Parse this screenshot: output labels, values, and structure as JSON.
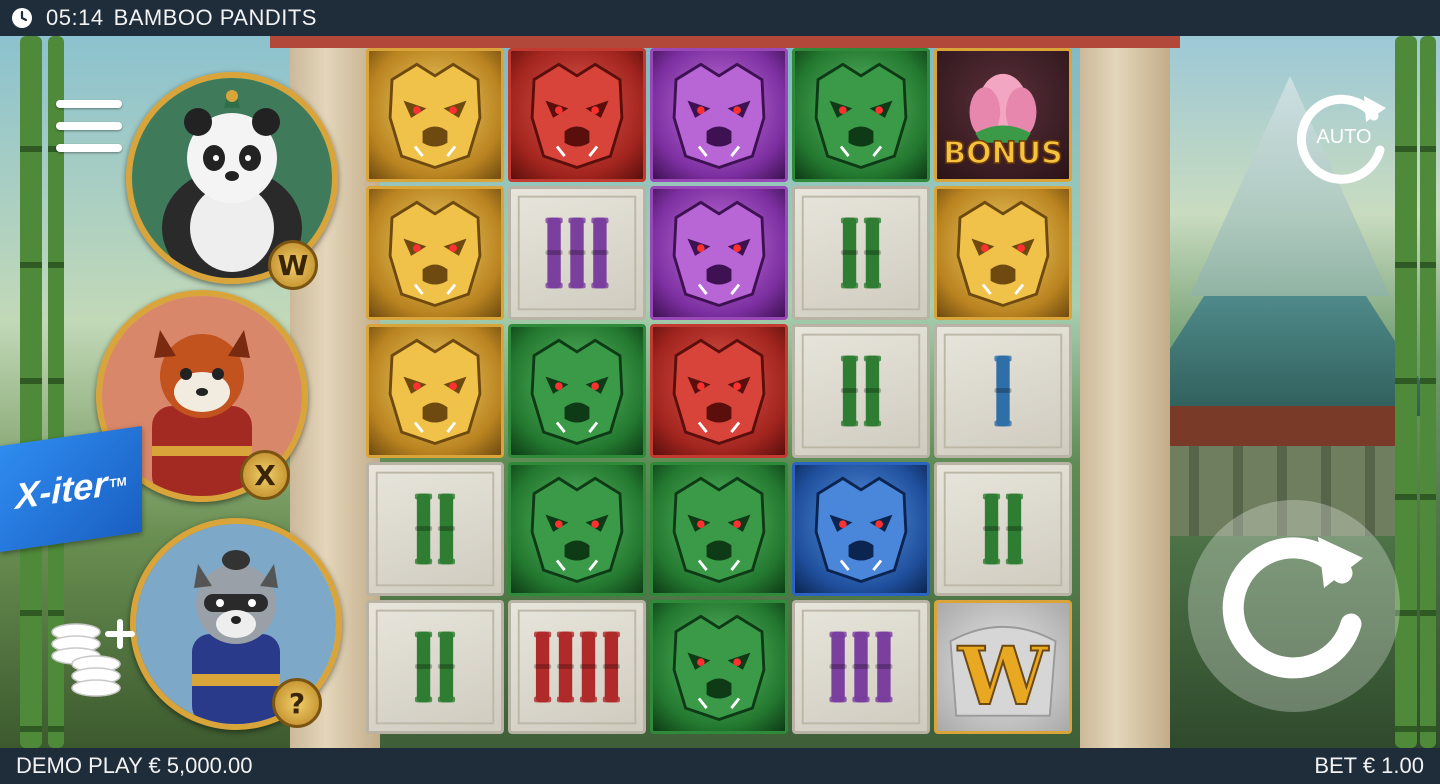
{
  "status_bar": {
    "time": "05:14",
    "title": "BAMBOO PANDITS"
  },
  "footer": {
    "balance_label": "DEMO PLAY € 5,000.00",
    "bet_label": "BET € 1.00"
  },
  "controls": {
    "auto_label": "AUTO",
    "xiter_label": "X-iter",
    "xiter_tm": "TM"
  },
  "characters": [
    {
      "name": "panda",
      "badge": "W"
    },
    {
      "name": "red-panda",
      "badge": "X"
    },
    {
      "name": "raccoon",
      "badge": "?"
    }
  ],
  "reels": {
    "rows": [
      [
        "gold-mask",
        "red-mask",
        "purple-mask",
        "green-mask",
        "bonus"
      ],
      [
        "gold-mask",
        "bamboo-3-purple",
        "purple-mask",
        "bamboo-2-green",
        "gold-mask"
      ],
      [
        "gold-mask",
        "green-mask",
        "red-mask",
        "bamboo-2-green",
        "bamboo-1-blue"
      ],
      [
        "bamboo-2-green",
        "green-mask",
        "green-mask",
        "blue-mask",
        "bamboo-2-green"
      ],
      [
        "bamboo-2-green",
        "bamboo-4-red",
        "green-mask",
        "bamboo-3-purple",
        "wild"
      ]
    ],
    "bonus_label": "BONUS",
    "wild_label": "W"
  },
  "colors": {
    "bar_bg": "#1f2c3a",
    "gold": "#d9a43a",
    "xiter_blue": "#2f8cf0",
    "bamboo_green": "#2e7d32",
    "bamboo_purple": "#7b3f9e",
    "bamboo_red": "#b02a2a",
    "bamboo_blue": "#2f6fa8"
  }
}
